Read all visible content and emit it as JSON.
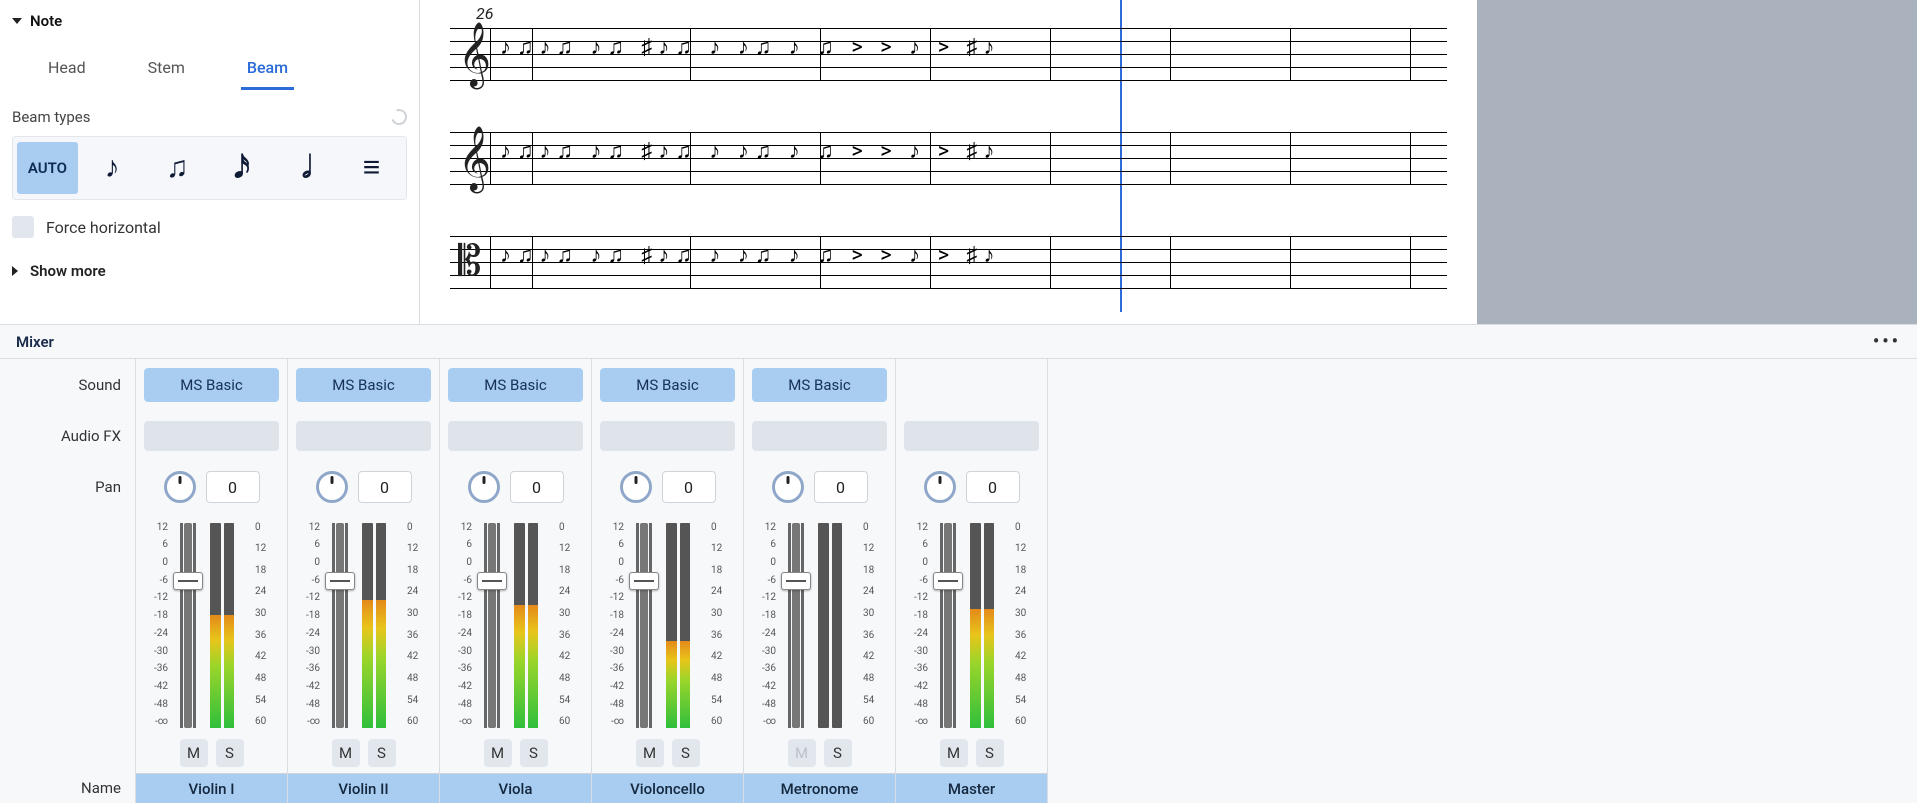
{
  "properties": {
    "section_title": "Note",
    "tabs": {
      "head": "Head",
      "stem": "Stem",
      "beam": "Beam"
    },
    "active_tab": "beam",
    "beam_types_label": "Beam types",
    "beam_auto_label": "AUTO",
    "beam_glyphs": [
      "♪",
      "♫",
      "𝅘𝅥𝅯",
      "𝅗𝅥",
      "≡"
    ],
    "force_horizontal_label": "Force horizontal",
    "show_more_label": "Show more"
  },
  "score": {
    "measure_number": "26",
    "staves": [
      {
        "clef": "𝄞"
      },
      {
        "clef": "𝄞"
      },
      {
        "clef": "𝄡"
      }
    ]
  },
  "mixer": {
    "title": "Mixer",
    "row_labels": {
      "sound": "Sound",
      "fx": "Audio FX",
      "pan": "Pan",
      "name": "Name"
    },
    "sound_label": "MS Basic",
    "mute_label": "M",
    "solo_label": "S",
    "left_scale": [
      "12",
      "6",
      "0",
      "-6",
      "-12",
      "-18",
      "-24",
      "-30",
      "-36",
      "-42",
      "-48",
      "-∞"
    ],
    "right_scale": [
      "0",
      "12",
      "18",
      "24",
      "30",
      "36",
      "42",
      "48",
      "54",
      "60"
    ],
    "channels": [
      {
        "id": "violin1",
        "name": "Violin I",
        "pan": 0,
        "has_sound": true,
        "fader_pos_pct": 24,
        "meter_fill_pct": 55,
        "mute_disabled": false
      },
      {
        "id": "violin2",
        "name": "Violin II",
        "pan": 0,
        "has_sound": true,
        "fader_pos_pct": 24,
        "meter_fill_pct": 62,
        "mute_disabled": false
      },
      {
        "id": "viola",
        "name": "Viola",
        "pan": 0,
        "has_sound": true,
        "fader_pos_pct": 24,
        "meter_fill_pct": 60,
        "mute_disabled": false
      },
      {
        "id": "cello",
        "name": "Violoncello",
        "pan": 0,
        "has_sound": true,
        "fader_pos_pct": 24,
        "meter_fill_pct": 42,
        "mute_disabled": false
      },
      {
        "id": "metronome",
        "name": "Metronome",
        "pan": 0,
        "has_sound": true,
        "fader_pos_pct": 24,
        "meter_fill_pct": 0,
        "mute_disabled": true
      },
      {
        "id": "master",
        "name": "Master",
        "pan": 0,
        "has_sound": false,
        "fader_pos_pct": 24,
        "meter_fill_pct": 58,
        "mute_disabled": false
      }
    ]
  }
}
